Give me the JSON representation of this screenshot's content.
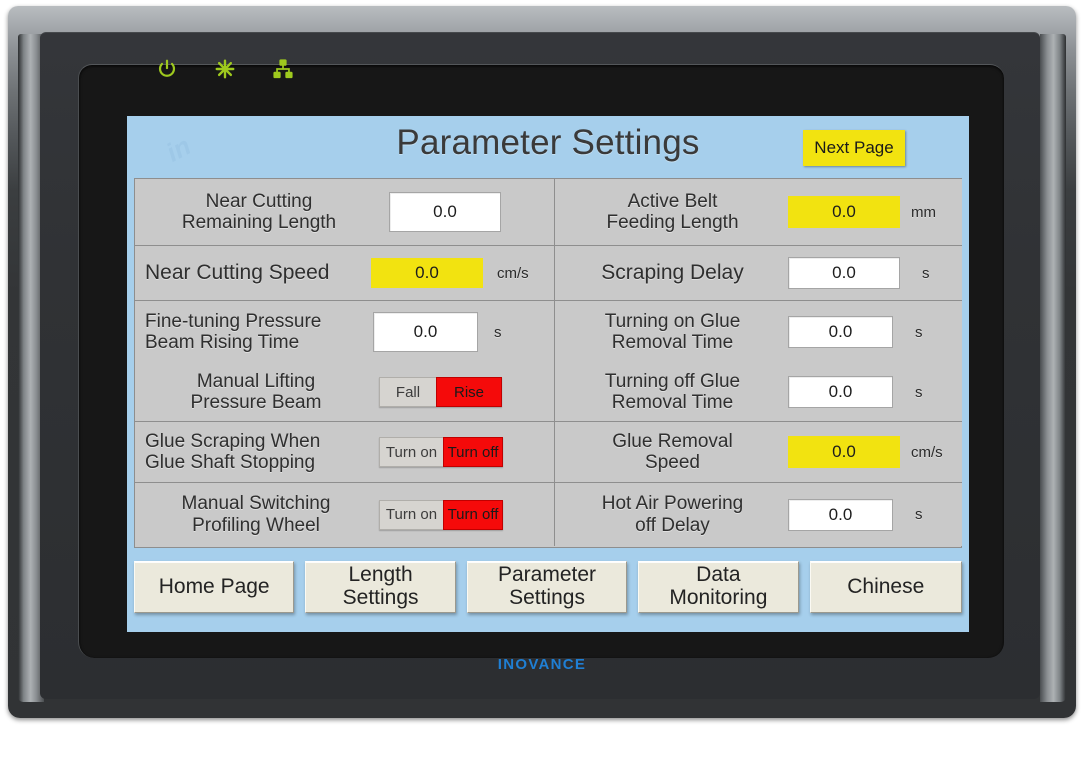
{
  "device": {
    "brand": "INOVANCE",
    "status_leds": [
      {
        "name": "power-led",
        "icon": "power-icon",
        "color": "#9ec91e"
      },
      {
        "name": "run-led",
        "icon": "asterisk-icon",
        "color": "#9ec91e"
      },
      {
        "name": "network-led",
        "icon": "network-icon",
        "color": "#9ec91e"
      }
    ]
  },
  "screen": {
    "title": "Parameter Settings",
    "next_page_label": "Next Page",
    "background_color": "#a6cfec",
    "accent_yellow": "#f2e310",
    "accent_red": "#f50a0a"
  },
  "parameters": {
    "left": [
      {
        "label_line1": "Near Cutting",
        "label_line2": "Remaining Length",
        "control": "input",
        "value": "0.0",
        "style": "white",
        "unit": ""
      },
      {
        "label_line1": "Near Cutting Speed",
        "label_line2": "",
        "control": "input",
        "value": "0.0",
        "style": "yellow",
        "unit": "cm/s"
      },
      {
        "label_line1": "Fine-tuning Pressure",
        "label_line2": "Beam Rising Time",
        "control": "input",
        "value": "0.0",
        "style": "white",
        "unit": "s"
      },
      {
        "label_line1": "Manual Lifting",
        "label_line2": "Pressure Beam",
        "control": "toggle",
        "option_off": "Fall",
        "option_on": "Rise",
        "active": "on",
        "unit": ""
      },
      {
        "label_line1": "Glue Scraping When",
        "label_line2": "Glue Shaft Stopping",
        "control": "toggle",
        "option_off": "Turn on",
        "option_on": "Turn off",
        "active": "on",
        "unit": ""
      },
      {
        "label_line1": "Manual Switching",
        "label_line2": "Profiling Wheel",
        "control": "toggle",
        "option_off": "Turn on",
        "option_on": "Turn off",
        "active": "on",
        "unit": ""
      }
    ],
    "right": [
      {
        "label_line1": "Active Belt",
        "label_line2": "Feeding Length",
        "control": "input",
        "value": "0.0",
        "style": "yellow",
        "unit": "mm"
      },
      {
        "label_line1": "Scraping Delay",
        "label_line2": "",
        "control": "input",
        "value": "0.0",
        "style": "white",
        "unit": "s"
      },
      {
        "label_line1": "Turning on Glue",
        "label_line2": "Removal Time",
        "control": "input",
        "value": "0.0",
        "style": "white",
        "unit": "s"
      },
      {
        "label_line1": "Turning off Glue",
        "label_line2": "Removal Time",
        "control": "input",
        "value": "0.0",
        "style": "white",
        "unit": "s"
      },
      {
        "label_line1": "Glue Removal",
        "label_line2": "Speed",
        "control": "input",
        "value": "0.0",
        "style": "yellow",
        "unit": "cm/s"
      },
      {
        "label_line1": "Hot Air Powering",
        "label_line2": "off Delay",
        "control": "input",
        "value": "0.0",
        "style": "white",
        "unit": "s"
      }
    ]
  },
  "nav": {
    "home_page": "Home Page",
    "length_settings_l1": "Length",
    "length_settings_l2": "Settings",
    "parameter_settings_l1": "Parameter",
    "parameter_settings_l2": "Settings",
    "data_monitoring_l1": "Data",
    "data_monitoring_l2": "Monitoring",
    "chinese": "Chinese"
  }
}
